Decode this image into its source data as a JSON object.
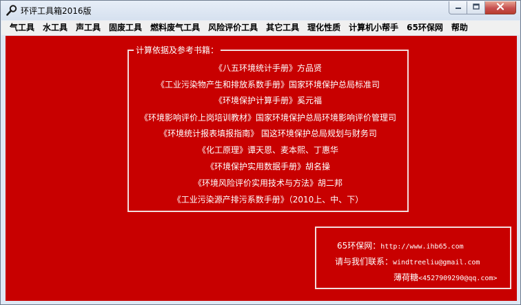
{
  "window": {
    "title": "环评工具箱2016版"
  },
  "menu": {
    "items": [
      "气工具",
      "水工具",
      "声工具",
      "固废工具",
      "燃料废气工具",
      "风险评价工具",
      "其它工具",
      "理化性质",
      "计算机小帮手",
      "65环保网",
      "帮助"
    ]
  },
  "references": {
    "legend": "计算依据及参考书籍：",
    "lines": [
      "《八五环境统计手册》方品贤",
      "《工业污染物产生和排放系数手册》国家环境保护总局标准司",
      "《环境保护计算手册》奚元福",
      "《环境影响评价上岗培训教材》国家环境保护总局环境影响评价管理司",
      "《环境统计报表填报指南》  国这环境保护总局规划与财务司",
      "《化工原理》谭天恩、麦本熙、丁惠华",
      "《环境保护实用数据手册》胡名操",
      "《环境风险评价实用技术与方法》胡二邦",
      "《工业污染源产排污系数手册》（2010上、中、下）"
    ]
  },
  "contact": {
    "site_label": "65环保网：",
    "site_url": "http://www.ihb65.com",
    "contact_label": "请与我们联系：",
    "email": "windtreeliu@gmail.com",
    "author_name": "薄荷糖",
    "author_contact": "<4527909290@qq.com>"
  },
  "colors": {
    "client_background": "#c80000",
    "text": "#ffffff"
  }
}
